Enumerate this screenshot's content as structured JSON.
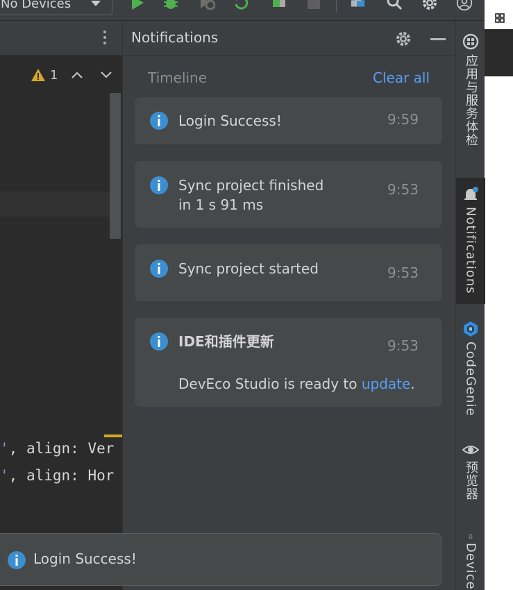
{
  "toolbar": {
    "device_label": "No Devices",
    "icons": [
      "run-icon",
      "debug-icon",
      "profile-icon",
      "apply-changes-icon",
      "apply-code-changes-icon",
      "stop-icon",
      "project-structure-icon",
      "search-icon",
      "settings-icon",
      "account-icon"
    ]
  },
  "editor": {
    "warning_count": "1",
    "code_lines": [
      {
        "quote": "'",
        "rest": ", align: Ver"
      },
      {
        "quote": "'",
        "rest": ", align: Hor"
      }
    ]
  },
  "notifications": {
    "title": "Notifications",
    "timeline_label": "Timeline",
    "clear_all_label": "Clear all",
    "items": [
      {
        "message": "Login Success!",
        "time": "9:59"
      },
      {
        "message_line1": "Sync project finished",
        "message_line2": "in 1 s 91 ms",
        "time": "9:53"
      },
      {
        "message": "Sync project started",
        "time": "9:53"
      },
      {
        "title": "IDE和插件更新",
        "time": "9:53",
        "body_prefix": "DevEco Studio is ready to ",
        "link": "update",
        "body_suffix": "."
      }
    ]
  },
  "toast": {
    "message": "Login Success!"
  },
  "tool_strip": {
    "tabs": [
      {
        "label": "应用与服务体检",
        "icon": "app-check-icon"
      },
      {
        "label": "Notifications",
        "icon": "bell-icon"
      },
      {
        "label": "CodeGenie",
        "icon": "codegenie-icon"
      },
      {
        "label": "预览器",
        "icon": "eye-icon"
      },
      {
        "label": "Device",
        "icon": "device-icon"
      }
    ]
  },
  "colors": {
    "accent": "#589df6",
    "info": "#3b8fd0",
    "warning": "#d4a62a",
    "run_green": "#4fb04f"
  }
}
